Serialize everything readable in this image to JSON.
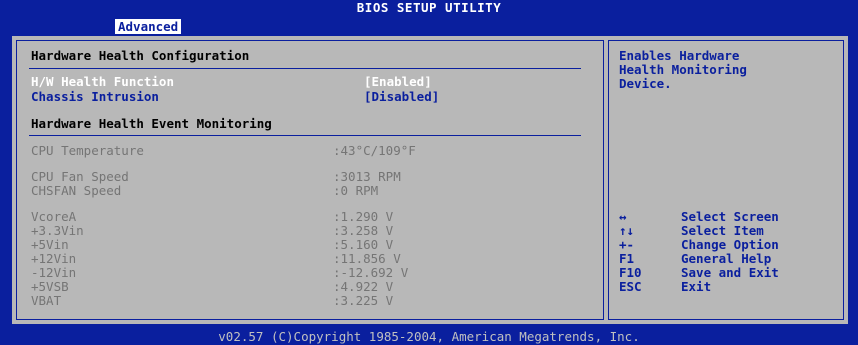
{
  "title": "BIOS SETUP UTILITY",
  "active_tab": "Advanced",
  "main": {
    "heading1": "Hardware Health Configuration",
    "options": [
      {
        "label": "H/W Health Function",
        "value": "[Enabled]"
      },
      {
        "label": "Chassis Intrusion",
        "value": "[Disabled]"
      }
    ],
    "heading2": "Hardware Health Event Monitoring",
    "readings": [
      {
        "label": "CPU Temperature",
        "value": ":43°C/109°F"
      },
      {
        "label": "CPU Fan Speed",
        "value": ":3013 RPM"
      },
      {
        "label": "CHSFAN Speed",
        "value": ":0 RPM"
      },
      {
        "label": "VcoreA",
        "value": ":1.290 V"
      },
      {
        "label": "+3.3Vin",
        "value": ":3.258 V"
      },
      {
        "label": "+5Vin",
        "value": ":5.160 V"
      },
      {
        "label": "+12Vin",
        "value": ":11.856 V"
      },
      {
        "label": "-12Vin",
        "value": ":-12.692 V"
      },
      {
        "label": "+5VSB",
        "value": ":4.922 V"
      },
      {
        "label": "VBAT",
        "value": ":3.225 V"
      }
    ]
  },
  "help": {
    "lines": [
      "Enables Hardware",
      "Health Monitoring",
      "Device."
    ],
    "keys": [
      {
        "key": "↔",
        "action": "Select Screen"
      },
      {
        "key": "↑↓",
        "action": "Select Item"
      },
      {
        "key": "+-",
        "action": "Change Option"
      },
      {
        "key": "F1",
        "action": "General Help"
      },
      {
        "key": "F10",
        "action": "Save and Exit"
      },
      {
        "key": "ESC",
        "action": "Exit"
      }
    ]
  },
  "footer": "v02.57 (C)Copyright 1985-2004, American Megatrends, Inc.",
  "colors": {
    "background": "#0a1f9e",
    "panel": "#b8b8b8",
    "highlight": "#ffffff",
    "readonly": "#757575"
  }
}
